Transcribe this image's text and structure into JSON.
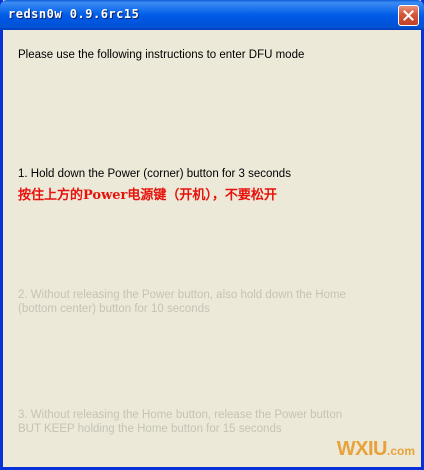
{
  "window": {
    "title": "redsn0w 0.9.6rc15"
  },
  "instructions": {
    "intro": "Please use the following instructions to enter DFU mode",
    "step1": "1. Hold down the Power (corner) button for 3 seconds",
    "step1_chinese": "按住上方的Power电源键（开机），不要松开",
    "step2_line1": "2. Without releasing the Power button, also hold down the Home",
    "step2_line2": "(bottom center) button for 10 seconds",
    "step3_line1": "3. Without releasing the Home button, release the Power button",
    "step3_line2": "BUT KEEP holding the Home button for 15 seconds"
  },
  "watermark": {
    "main": "WXIU",
    "domain": ".com"
  },
  "colors": {
    "titlebar": "#0058e6",
    "window_bg": "#ece9d8",
    "active_text": "#000000",
    "disabled_text": "#c6c3b6",
    "chinese_text": "#e8120c",
    "close_button": "#d6563a"
  },
  "icons": {
    "close": "close-icon"
  }
}
